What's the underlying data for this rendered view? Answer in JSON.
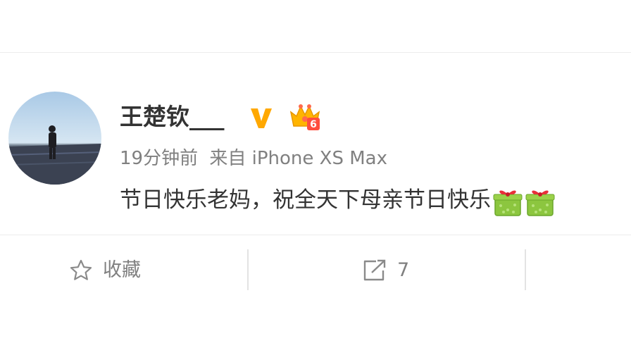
{
  "post": {
    "username": "王楚钦___",
    "verified_icon": "verified-v-icon",
    "member_badge_icon": "crown-member-badge-icon",
    "member_level": "6",
    "time": "19分钟前",
    "source": "来自 iPhone XS Max",
    "text": "节日快乐老妈，祝全天下母亲节日快乐",
    "emoji": [
      "gift-emoji",
      "gift-emoji"
    ]
  },
  "actions": {
    "favorite_label": "收藏",
    "repost_count": "7"
  },
  "colors": {
    "text_primary": "#333333",
    "text_secondary": "#808080",
    "verified_orange": "#ffa800",
    "divider": "#ececec"
  }
}
